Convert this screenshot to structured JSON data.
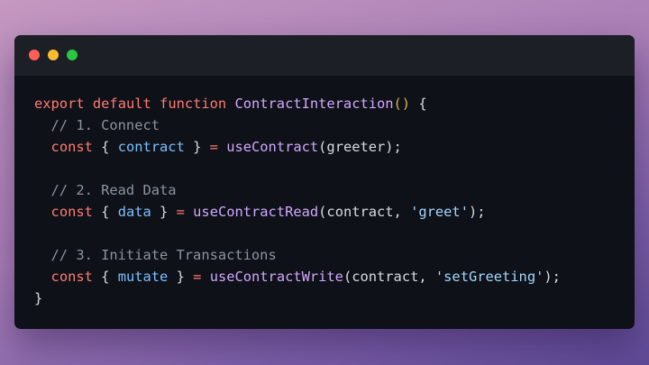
{
  "colors": {
    "keyword": "#ff7b72",
    "function": "#d2a8ff",
    "variable": "#79c0ff",
    "string": "#a5d6ff",
    "comment": "#8b949e",
    "plain": "#d7dce3",
    "paren": "#e3b341",
    "dot_close": "#ff5f57",
    "dot_minimize": "#febc2e",
    "dot_maximize": "#28c840"
  },
  "window": {
    "controls": [
      "close",
      "minimize",
      "maximize"
    ]
  },
  "code": {
    "lines": [
      [
        {
          "t": "export",
          "k": "keyword"
        },
        {
          "t": " ",
          "k": "plain"
        },
        {
          "t": "default",
          "k": "keyword"
        },
        {
          "t": " ",
          "k": "plain"
        },
        {
          "t": "function",
          "k": "keyword"
        },
        {
          "t": " ",
          "k": "plain"
        },
        {
          "t": "ContractInteraction",
          "k": "function"
        },
        {
          "t": "()",
          "k": "paren"
        },
        {
          "t": " {",
          "k": "plain"
        }
      ],
      [
        {
          "t": "  // 1. Connect",
          "k": "comment"
        }
      ],
      [
        {
          "t": "  ",
          "k": "plain"
        },
        {
          "t": "const",
          "k": "keyword"
        },
        {
          "t": " { ",
          "k": "plain"
        },
        {
          "t": "contract",
          "k": "variable"
        },
        {
          "t": " } ",
          "k": "plain"
        },
        {
          "t": "=",
          "k": "keyword"
        },
        {
          "t": " ",
          "k": "plain"
        },
        {
          "t": "useContract",
          "k": "function"
        },
        {
          "t": "(greeter);",
          "k": "plain"
        }
      ],
      [],
      [
        {
          "t": "  // 2. Read Data",
          "k": "comment"
        }
      ],
      [
        {
          "t": "  ",
          "k": "plain"
        },
        {
          "t": "const",
          "k": "keyword"
        },
        {
          "t": " { ",
          "k": "plain"
        },
        {
          "t": "data",
          "k": "variable"
        },
        {
          "t": " } ",
          "k": "plain"
        },
        {
          "t": "=",
          "k": "keyword"
        },
        {
          "t": " ",
          "k": "plain"
        },
        {
          "t": "useContractRead",
          "k": "function"
        },
        {
          "t": "(contract, ",
          "k": "plain"
        },
        {
          "t": "'greet'",
          "k": "string"
        },
        {
          "t": ");",
          "k": "plain"
        }
      ],
      [],
      [
        {
          "t": "  // 3. Initiate Transactions",
          "k": "comment"
        }
      ],
      [
        {
          "t": "  ",
          "k": "plain"
        },
        {
          "t": "const",
          "k": "keyword"
        },
        {
          "t": " { ",
          "k": "plain"
        },
        {
          "t": "mutate",
          "k": "variable"
        },
        {
          "t": " } ",
          "k": "plain"
        },
        {
          "t": "=",
          "k": "keyword"
        },
        {
          "t": " ",
          "k": "plain"
        },
        {
          "t": "useContractWrite",
          "k": "function"
        },
        {
          "t": "(contract, ",
          "k": "plain"
        },
        {
          "t": "'setGreeting'",
          "k": "string"
        },
        {
          "t": ");",
          "k": "plain"
        }
      ],
      [
        {
          "t": "}",
          "k": "plain"
        }
      ]
    ]
  }
}
